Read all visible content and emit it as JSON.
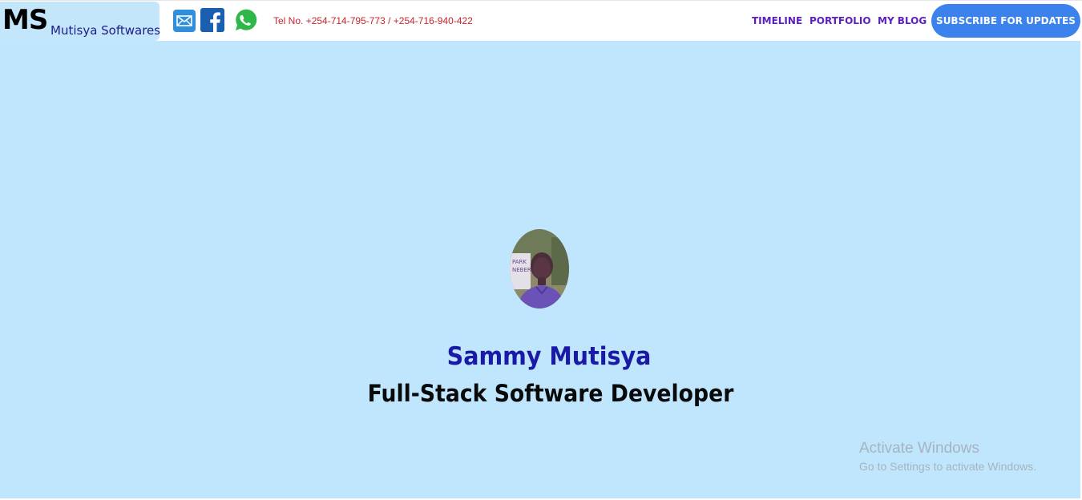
{
  "header": {
    "logo": {
      "initials": "MS",
      "name": "Mutisya Softwares"
    },
    "social": [
      {
        "name": "mail",
        "icon": "mail-icon",
        "color": "#2f8fdc"
      },
      {
        "name": "facebook",
        "icon": "facebook-icon",
        "color": "#1b5fb0"
      },
      {
        "name": "whatsapp",
        "icon": "whatsapp-icon",
        "color": "#2fb84a"
      }
    ],
    "tel": "Tel No. +254-714-795-773 / +254-716-940-422",
    "nav": {
      "timeline": "TIMELINE",
      "portfolio": "PORTFOLIO",
      "blog": "MY BLOG"
    },
    "subscribe_label": "SUBSCRIBE FOR UPDATES"
  },
  "hero": {
    "background": "#bfe6fd",
    "avatar_icon": "profile-photo",
    "name": "Sammy Mutisya",
    "role": "Full-Stack Software Developer"
  },
  "watermark": {
    "title": "Activate Windows",
    "subtitle": "Go to Settings to activate Windows."
  },
  "colors": {
    "accent": "#3b82ec",
    "nav": "#5b1fbf",
    "tel": "#c8252a",
    "name": "#1a1aa6"
  }
}
